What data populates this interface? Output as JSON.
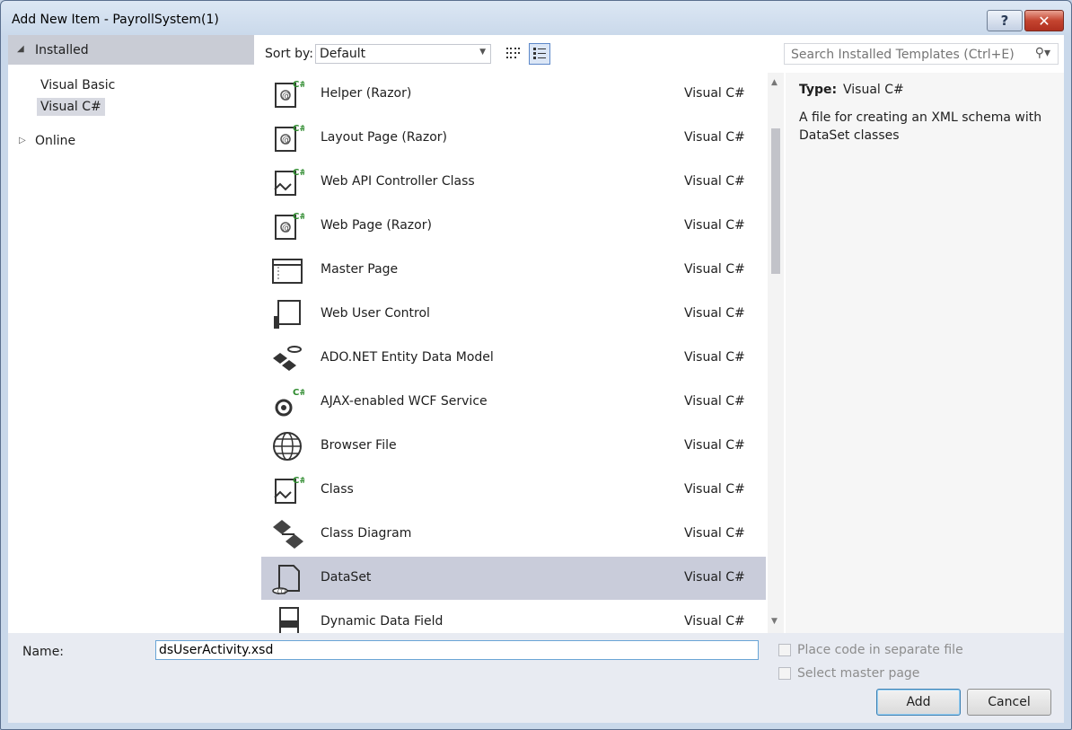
{
  "window": {
    "title": "Add New Item - PayrollSystem(1)",
    "help_glyph": "?",
    "close_glyph": "✕"
  },
  "tree": {
    "installed_label": "Installed",
    "items": [
      "Visual Basic",
      "Visual C#"
    ],
    "online_label": "Online"
  },
  "sort": {
    "label": "Sort by:",
    "value": "Default"
  },
  "search": {
    "placeholder": "Search Installed Templates (Ctrl+E)"
  },
  "templates": [
    {
      "name": "Helper (Razor)",
      "lang": "Visual C#",
      "icon": "razor-helper-icon"
    },
    {
      "name": "Layout Page (Razor)",
      "lang": "Visual C#",
      "icon": "razor-layout-icon"
    },
    {
      "name": "Web API Controller Class",
      "lang": "Visual C#",
      "icon": "web-api-controller-icon"
    },
    {
      "name": "Web Page (Razor)",
      "lang": "Visual C#",
      "icon": "razor-webpage-icon"
    },
    {
      "name": "Master Page",
      "lang": "Visual C#",
      "icon": "master-page-icon"
    },
    {
      "name": "Web User Control",
      "lang": "Visual C#",
      "icon": "user-control-icon"
    },
    {
      "name": "ADO.NET Entity Data Model",
      "lang": "Visual C#",
      "icon": "entity-model-icon"
    },
    {
      "name": "AJAX-enabled WCF Service",
      "lang": "Visual C#",
      "icon": "wcf-service-icon"
    },
    {
      "name": "Browser File",
      "lang": "Visual C#",
      "icon": "browser-file-icon"
    },
    {
      "name": "Class",
      "lang": "Visual C#",
      "icon": "class-icon"
    },
    {
      "name": "Class Diagram",
      "lang": "Visual C#",
      "icon": "class-diagram-icon"
    },
    {
      "name": "DataSet",
      "lang": "Visual C#",
      "icon": "dataset-icon"
    },
    {
      "name": "Dynamic Data Field",
      "lang": "Visual C#",
      "icon": "dynamic-data-field-icon"
    }
  ],
  "selected_template": "DataSet",
  "details": {
    "type_label": "Type:",
    "type_value": "Visual C#",
    "description": "A file for creating an XML schema with DataSet classes"
  },
  "bottom": {
    "name_label": "Name:",
    "name_value": "dsUserActivity.xsd",
    "place_code_label": "Place code in separate file",
    "select_master_label": "Select master page",
    "add_label": "Add",
    "cancel_label": "Cancel"
  },
  "colors": {
    "selection": "#c9ccda",
    "accent": "#3c7fb1",
    "csharp_badge": "#2e8b2e"
  }
}
